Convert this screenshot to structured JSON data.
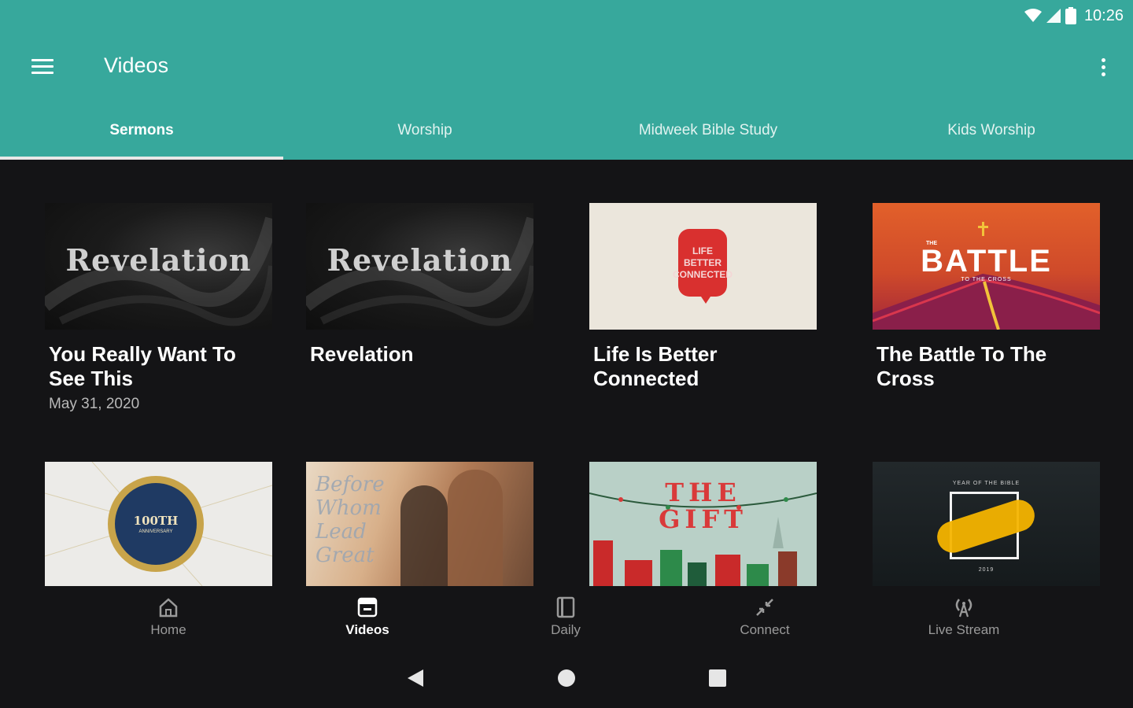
{
  "status": {
    "time": "10:26"
  },
  "appbar": {
    "title": "Videos",
    "menu_icon": "hamburger-menu-icon",
    "overflow_icon": "more-vert-icon"
  },
  "colors": {
    "header": "#37a89c",
    "background": "#141416"
  },
  "tabs": [
    {
      "label": "Sermons",
      "active": true
    },
    {
      "label": "Worship",
      "active": false
    },
    {
      "label": "Midweek Bible Study",
      "active": false
    },
    {
      "label": "Kids Worship",
      "active": false
    }
  ],
  "videos": [
    {
      "title": "You Really Want To See This",
      "date": "May 31, 2020",
      "thumb_text": "Revelation"
    },
    {
      "title": "Revelation",
      "date": "",
      "thumb_text": "Revelation"
    },
    {
      "title": "Life Is Better Connected",
      "date": "",
      "thumb_text": "LIFE BETTER CONNECTED"
    },
    {
      "title": "The Battle To The Cross",
      "date": "",
      "thumb_text": "BATTLE",
      "thumb_subtext": "TO THE CROSS",
      "thumb_kicker": "THE"
    },
    {
      "title": "",
      "date": "",
      "thumb_text": "100TH",
      "thumb_subtext": "ANNIVERSARY"
    },
    {
      "title": "",
      "date": "",
      "thumb_text": "Before Whom Lead Great"
    },
    {
      "title": "",
      "date": "",
      "thumb_text": "THE GIFT"
    },
    {
      "title": "",
      "date": "",
      "thumb_text": "YEAR OF THE BIBLE",
      "thumb_subtext": "2019"
    }
  ],
  "bottom_nav": [
    {
      "label": "Home",
      "icon": "home-icon",
      "active": false
    },
    {
      "label": "Videos",
      "icon": "videos-icon",
      "active": true
    },
    {
      "label": "Daily",
      "icon": "book-icon",
      "active": false
    },
    {
      "label": "Connect",
      "icon": "connect-arrows-icon",
      "active": false
    },
    {
      "label": "Live Stream",
      "icon": "broadcast-icon",
      "active": false
    }
  ],
  "system_nav": {
    "back": "back-icon",
    "home": "home-circle-icon",
    "recents": "recents-icon"
  }
}
